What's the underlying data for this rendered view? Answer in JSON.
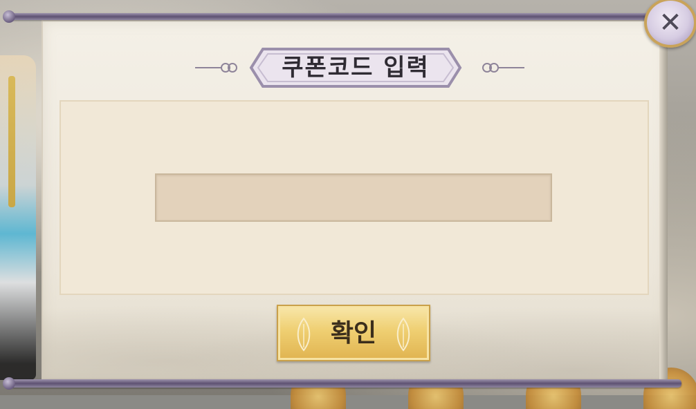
{
  "dialog": {
    "title": "쿠폰코드 입력",
    "input": {
      "value": "",
      "placeholder": ""
    },
    "confirm_label": "확인",
    "close_icon": "close-icon"
  },
  "colors": {
    "frame_purple": "#5e5272",
    "panel_bg": "#f4f0e7",
    "content_bg": "#f1e8d7",
    "input_bg": "#e3d2bb",
    "button_gold": "#efcf72",
    "close_gold_ring": "#c9a35a"
  }
}
